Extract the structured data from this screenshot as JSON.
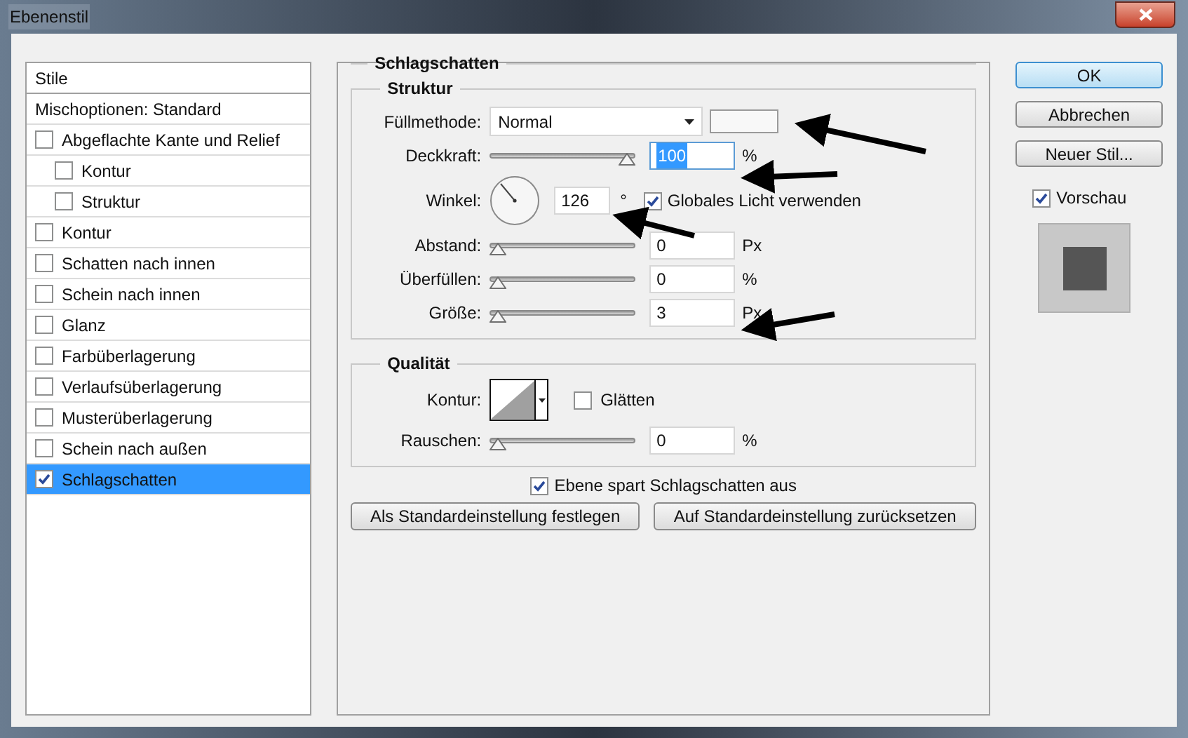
{
  "window": {
    "title": "Ebenenstil"
  },
  "styles_panel": {
    "header": "Stile",
    "items": [
      {
        "label": "Mischoptionen: Standard",
        "kind": "plain",
        "selected": false
      },
      {
        "label": "Abgeflachte Kante und Relief",
        "kind": "check",
        "checked": false,
        "selected": false,
        "children": [
          {
            "label": "Kontur",
            "kind": "check",
            "checked": false,
            "selected": false
          },
          {
            "label": "Struktur",
            "kind": "check",
            "checked": false,
            "selected": false
          }
        ]
      },
      {
        "label": "Kontur",
        "kind": "check",
        "checked": false,
        "selected": false
      },
      {
        "label": "Schatten nach innen",
        "kind": "check",
        "checked": false,
        "selected": false
      },
      {
        "label": "Schein nach innen",
        "kind": "check",
        "checked": false,
        "selected": false
      },
      {
        "label": "Glanz",
        "kind": "check",
        "checked": false,
        "selected": false
      },
      {
        "label": "Farbüberlagerung",
        "kind": "check",
        "checked": false,
        "selected": false
      },
      {
        "label": "Verlaufsüberlagerung",
        "kind": "check",
        "checked": false,
        "selected": false
      },
      {
        "label": "Musterüberlagerung",
        "kind": "check",
        "checked": false,
        "selected": false
      },
      {
        "label": "Schein nach außen",
        "kind": "check",
        "checked": false,
        "selected": false
      },
      {
        "label": "Schlagschatten",
        "kind": "check",
        "checked": true,
        "selected": true
      }
    ]
  },
  "settings": {
    "title": "Schlagschatten",
    "structure": {
      "title": "Struktur",
      "rows": [
        {
          "kind": "select",
          "label": "Füllmethode:",
          "value": "Normal"
        },
        {
          "kind": "slider",
          "label": "Deckkraft:",
          "level": 1,
          "value": "100",
          "unit": "%",
          "highlighted": true
        },
        {
          "kind": "angle",
          "label": "Winkel:",
          "value": "126",
          "unit": "°",
          "checkbox": {
            "label": "Globales Licht verwenden",
            "checked": true
          }
        },
        {
          "kind": "slider",
          "label": "Abstand:",
          "level": 0,
          "value": "0",
          "unit": "Px",
          "highlighted": false
        },
        {
          "kind": "slider",
          "label": "Überfüllen:",
          "level": 0,
          "value": "0",
          "unit": "%",
          "highlighted": false
        },
        {
          "kind": "slider",
          "label": "Größe:",
          "level": 0,
          "value": "3",
          "unit": "Px",
          "highlighted": false
        }
      ]
    },
    "quality": {
      "title": "Qualität",
      "rows": [
        {
          "kind": "contour",
          "label": "Kontur:",
          "checkbox": {
            "label": "Glätten",
            "checked": false
          }
        },
        {
          "kind": "slider",
          "label": "Rauschen:",
          "level": 0,
          "value": "0",
          "unit": "%",
          "highlighted": false
        }
      ]
    },
    "layer_knocks_out": {
      "label": "Ebene spart Schlagschatten aus",
      "checked": true
    },
    "buttons": [
      "Als Standardeinstellung festlegen",
      "Auf Standardeinstellung zurücksetzen"
    ]
  },
  "actions": {
    "buttons": [
      {
        "label": "OK",
        "default": true
      },
      {
        "label": "Abbrechen",
        "default": false
      },
      {
        "label": "Neuer Stil...",
        "default": false
      }
    ],
    "preview": {
      "label": "Vorschau",
      "checked": true
    }
  }
}
